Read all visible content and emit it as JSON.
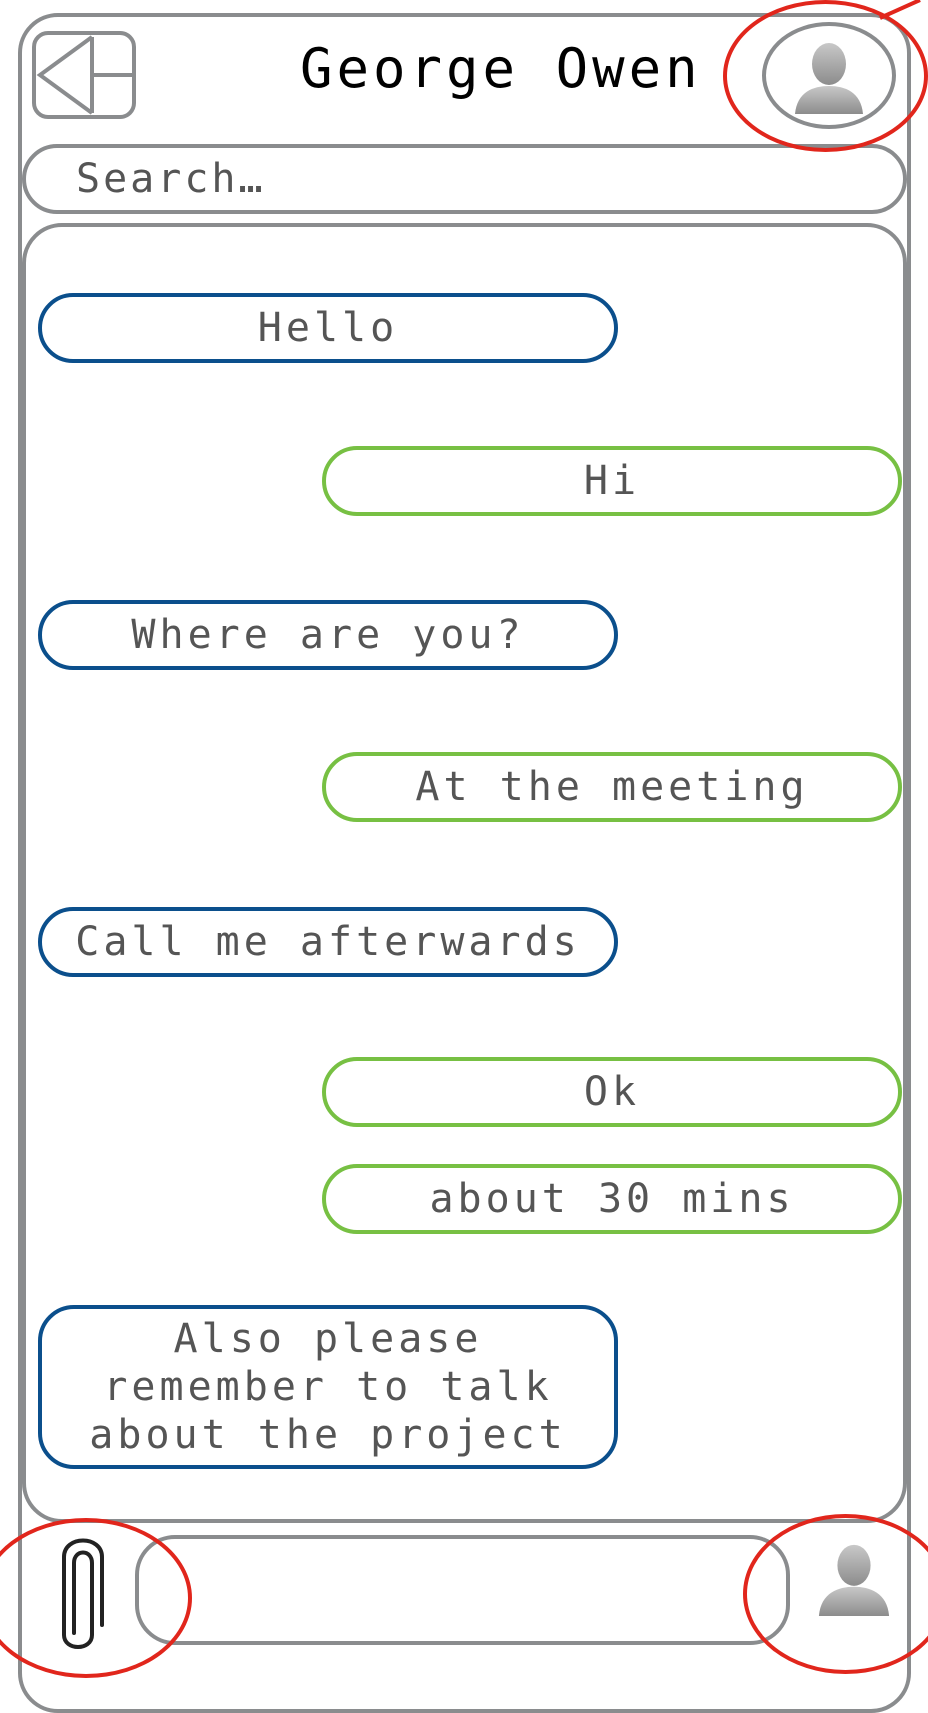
{
  "header": {
    "back_icon": "back-arrow-icon",
    "title": "George Owen",
    "avatar_icon": "user-avatar-icon"
  },
  "search": {
    "placeholder": "Search…"
  },
  "messages": [
    {
      "direction": "incoming",
      "text": "Hello"
    },
    {
      "direction": "outgoing",
      "text": "Hi"
    },
    {
      "direction": "incoming",
      "text": "Where are you?"
    },
    {
      "direction": "outgoing",
      "text": "At the meeting"
    },
    {
      "direction": "incoming",
      "text": "Call me afterwards"
    },
    {
      "direction": "outgoing",
      "text": "Ok"
    },
    {
      "direction": "outgoing",
      "text": "about 30 mins"
    },
    {
      "direction": "incoming",
      "text": "Also please remember to talk about the project"
    }
  ],
  "footer": {
    "attach_icon": "paperclip-icon",
    "message_input_value": "",
    "send_icon": "user-icon"
  },
  "colors": {
    "incoming_border": "#0b4f8c",
    "outgoing_border": "#77c043",
    "frame_gray": "#8a8c8e",
    "highlight_red": "#e1261c"
  }
}
